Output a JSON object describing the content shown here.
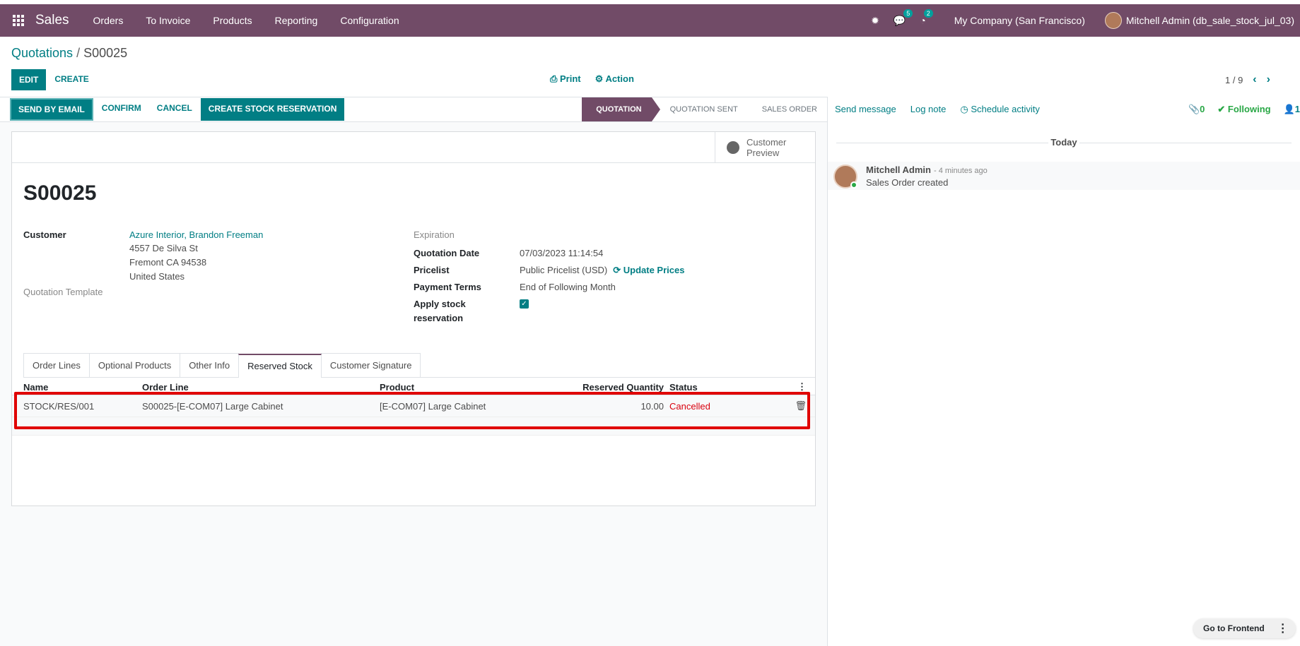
{
  "navbar": {
    "brand": "Sales",
    "menus": [
      "Orders",
      "To Invoice",
      "Products",
      "Reporting",
      "Configuration"
    ],
    "messages_badge": "5",
    "activities_badge": "2",
    "company": "My Company (San Francisco)",
    "user": "Mitchell Admin (db_sale_stock_jul_03)",
    "bug_icon": "bug-icon",
    "chat_icon": "chat-icon",
    "clock_icon": "clock-icon"
  },
  "breadcrumb": {
    "parent": "Quotations",
    "separator": " / ",
    "current": "S00025"
  },
  "control_panel": {
    "edit": "EDIT",
    "create": "CREATE",
    "print": "Print",
    "action": "Action",
    "pager": "1 / 9"
  },
  "statusbar": {
    "buttons": [
      "SEND BY EMAIL",
      "CONFIRM",
      "CANCEL",
      "CREATE STOCK RESERVATION"
    ],
    "stages": [
      "QUOTATION",
      "QUOTATION SENT",
      "SALES ORDER"
    ],
    "active_stage": "QUOTATION"
  },
  "smart_button": {
    "line1": "Customer",
    "line2": "Preview"
  },
  "record": {
    "name": "S00025",
    "customer_label": "Customer",
    "customer": "Azure Interior, Brandon Freeman",
    "address1": "4557 De Silva St",
    "address2": "Fremont CA 94538",
    "address3": "United States",
    "template_label": "Quotation Template",
    "expiration_label": "Expiration",
    "quotation_date_label": "Quotation Date",
    "quotation_date": "07/03/2023 11:14:54",
    "pricelist_label": "Pricelist",
    "pricelist": "Public Pricelist (USD)",
    "update_prices": "Update Prices",
    "payment_terms_label": "Payment Terms",
    "payment_terms": "End of Following Month",
    "apply_stock_label_1": "Apply stock",
    "apply_stock_label_2": "reservation",
    "apply_stock_checked": true
  },
  "tabs": [
    "Order Lines",
    "Optional Products",
    "Other Info",
    "Reserved Stock",
    "Customer Signature"
  ],
  "active_tab": "Reserved Stock",
  "table": {
    "headers": [
      "Name",
      "Order Line",
      "Product",
      "Reserved Quantity",
      "Status"
    ],
    "rows": [
      {
        "name": "STOCK/RES/001",
        "order_line": "S00025-[E-COM07] Large Cabinet",
        "product": "[E-COM07] Large Cabinet",
        "qty": "10.00",
        "status": "Cancelled"
      }
    ]
  },
  "chatter": {
    "send_message": "Send message",
    "log_note": "Log note",
    "schedule_activity": "Schedule activity",
    "attachments": "0",
    "following": "Following",
    "followers": "1",
    "today": "Today",
    "message": {
      "author": "Mitchell Admin",
      "ago": "- 4 minutes ago",
      "body": "Sales Order created"
    }
  },
  "go_frontend": "Go to Frontend",
  "colors": {
    "brand": "#714b67",
    "accent": "#017e84",
    "danger": "#d9000d",
    "highlight": "#e00000"
  }
}
